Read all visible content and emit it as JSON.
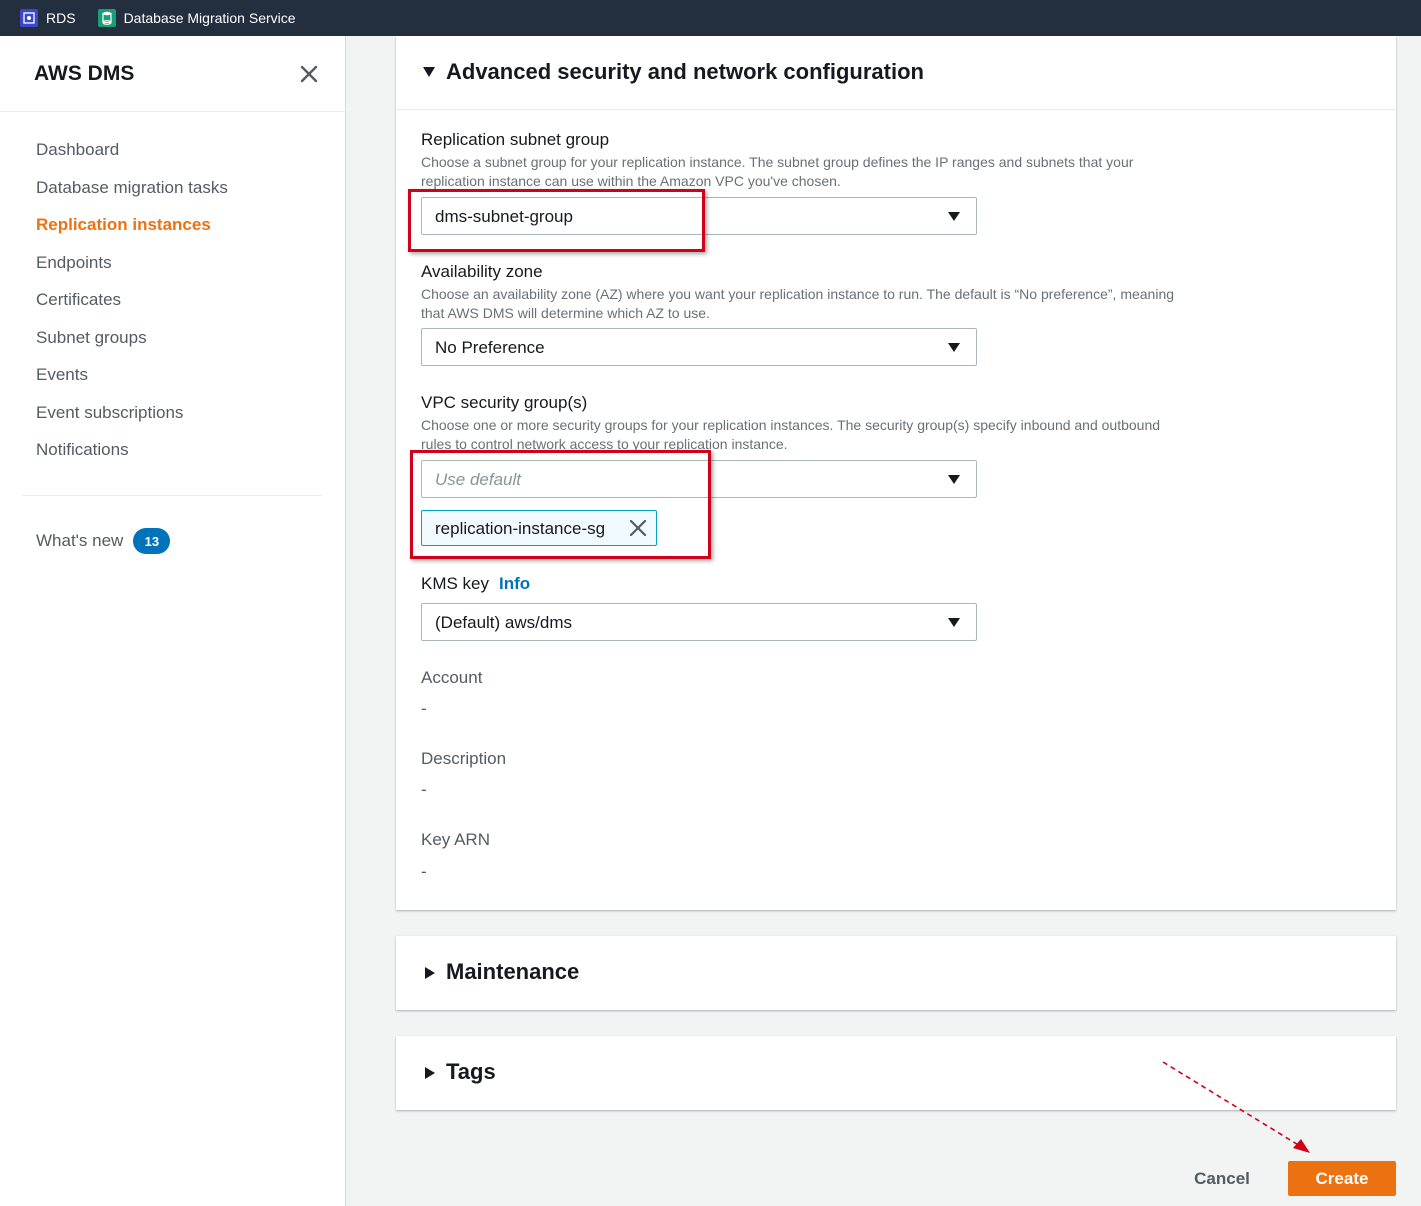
{
  "topbar": {
    "services": [
      {
        "label": "RDS",
        "icon": "rds-icon"
      },
      {
        "label": "Database Migration Service",
        "icon": "dms-icon"
      }
    ]
  },
  "sidebar": {
    "title": "AWS DMS",
    "items": [
      {
        "label": "Dashboard",
        "active": false
      },
      {
        "label": "Database migration tasks",
        "active": false
      },
      {
        "label": "Replication instances",
        "active": true
      },
      {
        "label": "Endpoints",
        "active": false
      },
      {
        "label": "Certificates",
        "active": false
      },
      {
        "label": "Subnet groups",
        "active": false
      },
      {
        "label": "Events",
        "active": false
      },
      {
        "label": "Event subscriptions",
        "active": false
      },
      {
        "label": "Notifications",
        "active": false
      }
    ],
    "whats_new": {
      "label": "What's new",
      "count": "13"
    }
  },
  "advanced": {
    "title": "Advanced security and network configuration",
    "subnet": {
      "label": "Replication subnet group",
      "desc": "Choose a subnet group for your replication instance. The subnet group defines the IP ranges and subnets that your replication instance can use within the Amazon VPC you've chosen.",
      "value": "dms-subnet-group"
    },
    "az": {
      "label": "Availability zone",
      "desc": "Choose an availability zone (AZ) where you want your replication instance to run. The default is “No preference”, meaning that AWS DMS will determine which AZ to use.",
      "value": "No Preference"
    },
    "vpc": {
      "label": "VPC security group(s)",
      "desc": "Choose one or more security groups for your replication instances. The security group(s) specify inbound and outbound rules to control network access to your replication instance.",
      "placeholder": "Use default",
      "token": "replication-instance-sg"
    },
    "kms": {
      "label": "KMS key",
      "info": "Info",
      "value": "(Default) aws/dms"
    },
    "account": {
      "label": "Account",
      "value": "-"
    },
    "description": {
      "label": "Description",
      "value": "-"
    },
    "key_arn": {
      "label": "Key ARN",
      "value": "-"
    }
  },
  "maintenance": {
    "title": "Maintenance"
  },
  "tags": {
    "title": "Tags"
  },
  "actions": {
    "cancel": "Cancel",
    "create": "Create"
  },
  "colors": {
    "accent": "#ec7211",
    "link": "#0073bb",
    "highlight": "#d0021b",
    "topbar": "#232f3e"
  }
}
